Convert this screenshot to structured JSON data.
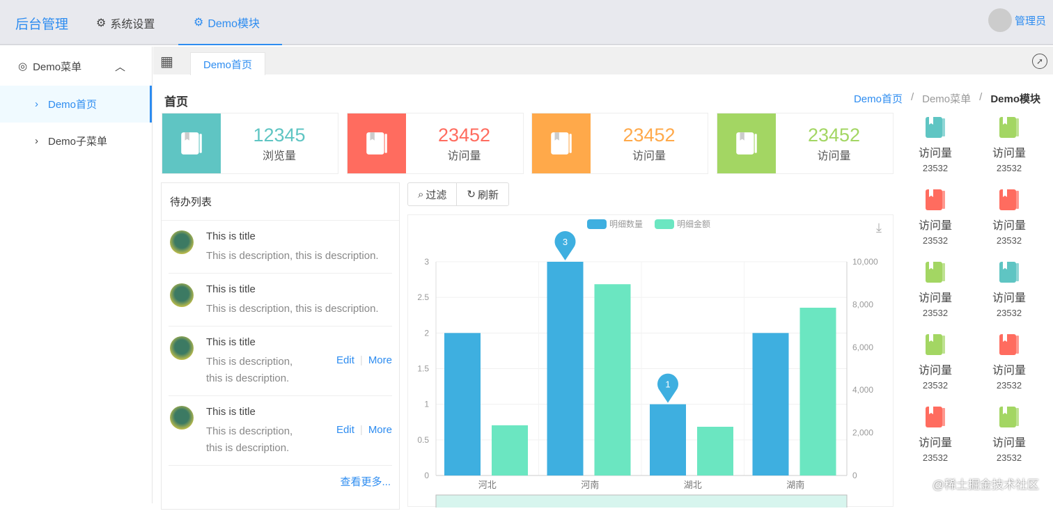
{
  "header": {
    "brand": "后台管理",
    "nav": [
      {
        "label": "系统设置",
        "icon": "gear-icon"
      },
      {
        "label": "Demo模块",
        "icon": "gear-icon",
        "active": true
      }
    ],
    "user": "管理员"
  },
  "sidebar": {
    "group": "Demo菜单",
    "items": [
      {
        "label": "Demo首页",
        "active": true
      },
      {
        "label": "Demo子菜单"
      }
    ]
  },
  "tabs": [
    {
      "label": "Demo首页"
    }
  ],
  "page": {
    "title": "首页",
    "breadcrumb": [
      "Demo首页",
      "Demo菜单",
      "Demo模块"
    ]
  },
  "stats": [
    {
      "value": "12345",
      "label": "浏览量",
      "color": "#5fc5c3"
    },
    {
      "value": "23452",
      "label": "访问量",
      "color": "#ff6c5f"
    },
    {
      "value": "23452",
      "label": "访问量",
      "color": "#ffa94a"
    },
    {
      "value": "23452",
      "label": "访问量",
      "color": "#a3d663"
    }
  ],
  "todo": {
    "title": "待办列表",
    "items": [
      {
        "title": "This is title",
        "desc": "This is description, this is description.",
        "actions": []
      },
      {
        "title": "This is title",
        "desc": "This is description, this is description.",
        "actions": []
      },
      {
        "title": "This is title",
        "desc": "This is description, this is description.",
        "actions": [
          "Edit",
          "More"
        ]
      },
      {
        "title": "This is title",
        "desc": "This is description, this is description.",
        "actions": [
          "Edit",
          "More"
        ]
      }
    ],
    "more": "查看更多..."
  },
  "toolbar": {
    "filter": "过滤",
    "refresh": "刷新"
  },
  "chart_data": {
    "type": "bar",
    "categories": [
      "河北",
      "河南",
      "湖北",
      "湖南"
    ],
    "series": [
      {
        "name": "明细数量",
        "axis": "left",
        "color": "#3eafe0",
        "values": [
          2,
          3,
          1,
          2
        ]
      },
      {
        "name": "明细金额",
        "axis": "right",
        "color": "#6be6c1",
        "values": [
          2350,
          8950,
          2280,
          7850
        ]
      }
    ],
    "ylim_left": [
      0,
      3
    ],
    "yticks_left": [
      "0",
      "0.5",
      "1",
      "1.5",
      "2",
      "2.5",
      "3"
    ],
    "ylim_right": [
      0,
      10000
    ],
    "yticks_right": [
      "0",
      "2,000",
      "4,000",
      "6,000",
      "8,000",
      "10,000"
    ],
    "markers": [
      {
        "category": "河南",
        "value": "3"
      },
      {
        "category": "湖北",
        "value": "1"
      }
    ],
    "legend": "top-center"
  },
  "right_panel": [
    {
      "label": "访问量",
      "value": "23532",
      "color": "#5fc5c3"
    },
    {
      "label": "访问量",
      "value": "23532",
      "color": "#a3d663"
    },
    {
      "label": "访问量",
      "value": "23532",
      "color": "#ff6c5f"
    },
    {
      "label": "访问量",
      "value": "23532",
      "color": "#ff6c5f"
    },
    {
      "label": "访问量",
      "value": "23532",
      "color": "#a3d663"
    },
    {
      "label": "访问量",
      "value": "23532",
      "color": "#5fc5c3"
    },
    {
      "label": "访问量",
      "value": "23532",
      "color": "#a3d663"
    },
    {
      "label": "访问量",
      "value": "23532",
      "color": "#ff6c5f"
    },
    {
      "label": "访问量",
      "value": "23532",
      "color": "#ff6c5f"
    },
    {
      "label": "访问量",
      "value": "23532",
      "color": "#a3d663"
    }
  ],
  "watermark": "@稀土掘金技术社区"
}
